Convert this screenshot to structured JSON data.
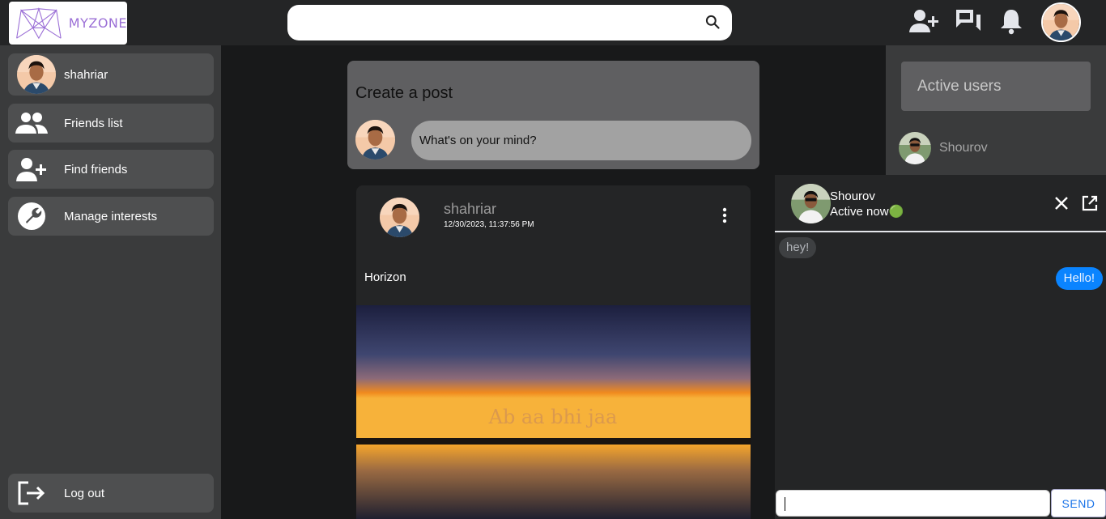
{
  "app": {
    "logo_text": "MYZONE"
  },
  "search": {
    "placeholder": ""
  },
  "profile": {
    "name": "shahriar"
  },
  "sidebar": {
    "items": [
      {
        "label": "shahriar",
        "icon": "avatar"
      },
      {
        "label": "Friends list",
        "icon": "group-icon"
      },
      {
        "label": "Find friends",
        "icon": "person-add-icon"
      },
      {
        "label": "Manage interests",
        "icon": "wrench-icon"
      }
    ],
    "logout_label": "Log out"
  },
  "create_post": {
    "title": "Create a post",
    "placeholder": "What's on your mind?"
  },
  "post": {
    "author": "shahriar",
    "timestamp": "12/30/2023, 11:37:56 PM",
    "text": "Horizon",
    "image_caption": "Ab aa bhi jaa"
  },
  "active_users": {
    "title": "Active users",
    "users": [
      {
        "name": "Shourov"
      }
    ]
  },
  "chat": {
    "contact_name": "Shourov",
    "status": "Active now🟢",
    "messages": [
      {
        "direction": "in",
        "text": "hey!"
      },
      {
        "direction": "out",
        "text": "Hello!"
      }
    ],
    "input_value": "",
    "send_label": "SEND"
  },
  "colors": {
    "accent": "#0a84ff",
    "sidebar_bg": "#3a3b3c",
    "page_bg": "#18191a"
  }
}
